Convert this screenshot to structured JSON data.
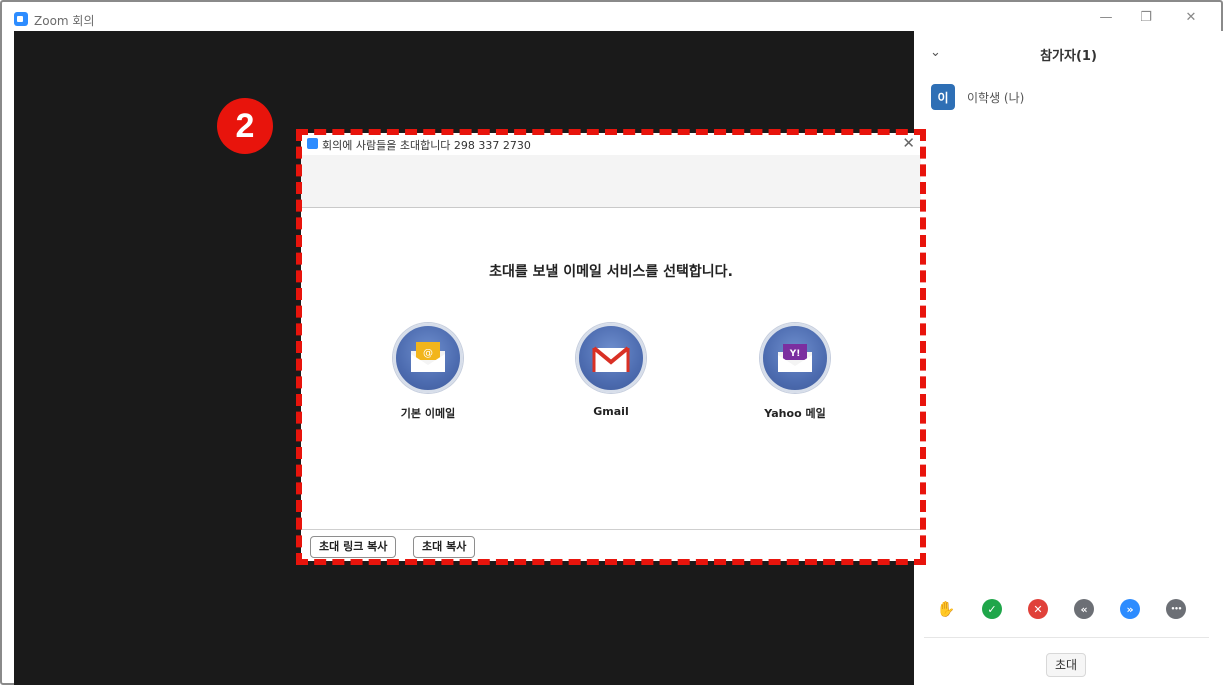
{
  "window": {
    "title": "Zoom 회의",
    "minimize": "—",
    "restore": "❐",
    "close": "✕"
  },
  "participants": {
    "title": "참가자(1)",
    "collapse_icon": "chevron-down-icon",
    "list": [
      {
        "avatar": "이",
        "name": "이학생 (나)"
      }
    ],
    "reactions": [
      {
        "icon": "raise-hand-icon",
        "glyph": "✋",
        "color": "#2d8cff"
      },
      {
        "icon": "yes-icon",
        "glyph": "✓",
        "color": "#1fa64a"
      },
      {
        "icon": "no-icon",
        "glyph": "✕",
        "color": "#e0413a"
      },
      {
        "icon": "go-slower-icon",
        "glyph": "«",
        "color": "#6c6f75"
      },
      {
        "icon": "go-faster-icon",
        "glyph": "»",
        "color": "#2d8cff"
      },
      {
        "icon": "more-icon",
        "glyph": "•••",
        "color": "#6c6f75"
      }
    ],
    "invite_label": "초대"
  },
  "badge": {
    "number": "2"
  },
  "dialog": {
    "title": "회의에 사람들을 초대합니다 298 337 2730",
    "close": "✕",
    "heading": "초대를 보낼 이메일 서비스를 선택합니다.",
    "services": [
      {
        "label": "기본 이메일",
        "icon": "default-email-icon"
      },
      {
        "label": "Gmail",
        "icon": "gmail-icon"
      },
      {
        "label": "Yahoo 메일",
        "icon": "yahoo-mail-icon"
      }
    ],
    "buttons": {
      "copy_link": "초대 링크 복사",
      "copy_invite": "초대 복사"
    }
  },
  "colors": {
    "highlight": "#e8140c",
    "zoom_blue": "#2d8cff",
    "video_bg": "#1a1a1a"
  }
}
